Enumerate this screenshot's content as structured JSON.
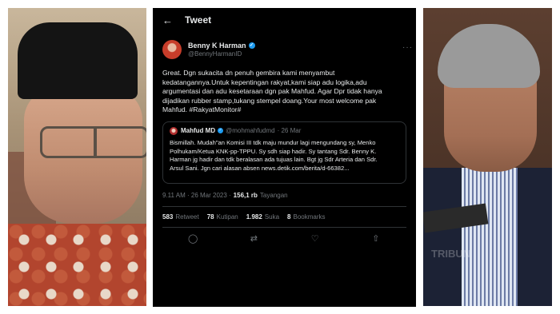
{
  "tweet": {
    "header": {
      "back_icon": "←",
      "title": "Tweet"
    },
    "author": {
      "name": "Benny K Harman",
      "handle": "@BennyHarmanID",
      "more_icon": "···"
    },
    "text": "Great. Dgn sukacita dn penuh gembira kami menyambut\nkedatangannya.Untuk kepentingan rakyat,kami siap adu logika,adu\nargumentasi dan adu kesetaraan dgn pak Mahfud. Agar Dpr tidak hanya\ndijadikan rubber stamp,tukang stempel doang.Your most welcome pak\nMahfud. #RakyatMonitor#",
    "quote": {
      "name": "Mahfud MD",
      "handle": "@mohmahfudmd",
      "date": "· 26 Mar",
      "text": "Bismillah. Mudah\"an Komisi III tdk maju mundur lagi mengundang sy, Menko\nPolhukam/Ketua KNK-pp-TPPU. Sy sdh siap hadir. Sy tantang Sdr. Benny K.\nHarman jg hadir dan tdk beralasan ada tujuas lain. Bgt jg Sdr Arteria dan Sdr.\nArsul Sani. Jgn cari alasan absen news.detik.com/berita/d-66382..."
    },
    "meta": {
      "time": "9.11 AM · 26 Mar 2023 ·",
      "views": "156,1 rb",
      "views_label": "Tayangan"
    },
    "stats": [
      {
        "value": "583",
        "label": "Retweet"
      },
      {
        "value": "78",
        "label": "Kutipan"
      },
      {
        "value": "1.982",
        "label": "Suka"
      },
      {
        "value": "8",
        "label": "Bookmarks"
      }
    ],
    "actions": {
      "reply_icon": "◯",
      "retweet_icon": "⇄",
      "like_icon": "♡",
      "share_icon": "⇧"
    }
  },
  "photos": {
    "right_watermark": "TRIBUN"
  }
}
